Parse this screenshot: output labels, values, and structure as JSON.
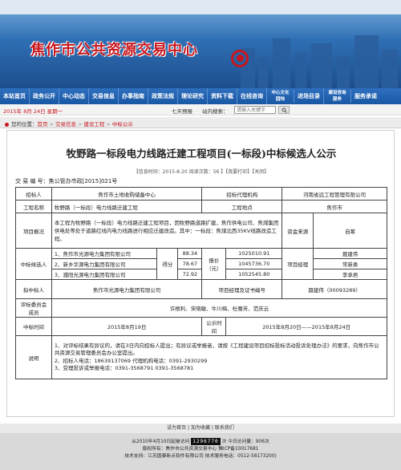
{
  "banner": {
    "title": "焦作市公共资源交易中心"
  },
  "nav": {
    "items": [
      "本站首页",
      "政务公开",
      "中心动态",
      "交易信息",
      "办事指南",
      "政策法规",
      "理论研究",
      "资料下载",
      "在线咨询"
    ],
    "small_items": [
      "中心文化园地",
      "进场目录",
      "建设咨询服务",
      "服务承诺"
    ]
  },
  "toolbar": {
    "date": "2015年 8月 24日 星期一",
    "weather": "七天预报",
    "search_label": "站内搜索：",
    "search_placeholder": "请输入关键字"
  },
  "breadcrumb": {
    "prefix": "您的位置：",
    "items": [
      "首页",
      "交易信息",
      "建设工程",
      "中标公示"
    ]
  },
  "article": {
    "title": "牧野路一标段电力线路迁建工程项目(一标段)中标候选人公示",
    "meta": "【信息时间：2015-8-20  阅读次数：56 】【我要打印】【关闭】",
    "doc_no": "交 易 编 号：焦公管办市政[2015]021号"
  },
  "table": {
    "label_tenderer": "招标人",
    "tenderer": "焦作市土地收购储备中心",
    "label_agent": "招标代理机构",
    "agent": "河南省远工程管理有限公司",
    "label_project": "工程名称",
    "project": "牧野路（一标段）电力线路迁建工程",
    "label_location": "工程地点",
    "location": "焦作市",
    "label_overview": "项目概况",
    "overview": "本工程为牧野路（一标段）电力线路迁建工程项目，因牧野路道路扩建，焦作供电公司、焦煤集团供电处等处于道路红线内电力线路进行相应迁建改造。其中：一标段：焦煤北西35KV线路改造工程。",
    "label_fund": "资金来源",
    "fund": "自筹",
    "label_candidates": "中标候选人",
    "candidates": [
      "1、焦作市光源电力集团有限公司",
      "2、新乡华源电力集团有限公司",
      "3、濮阳光源电力集团有限公司"
    ],
    "scores": [
      "88.34",
      "78.67",
      "72.92"
    ],
    "label_score": "得分",
    "label_price": "报价（元）",
    "prices": [
      "1025010.91",
      "1045736.70",
      "1052545.80"
    ],
    "label_pm": "项目经理",
    "pms": [
      "聂建伟",
      "常新勇",
      "李承君"
    ],
    "label_winner": "拟中标人",
    "winner": "焦作市光源电力集团有限公司",
    "label_cert": "项目经理及证书编号",
    "cert": "聂建伟（00093289）",
    "label_committee": "评标委员会成员",
    "committee": "许根利、宋晓敏、牛川梅、杜骞芳、范庆云",
    "label_bid_time": "中标时间",
    "bid_time": "2015年8月19日",
    "label_notice_time": "公示时间",
    "notice_time": "2015年8月20日——2015年8月24日",
    "label_note": "说明",
    "notes": [
      "1、对评标结果有异议的，请在3日内向招标人提出；有异议或举报者，请按《工程建设项目招标投标活动投诉处理办法》的要求，向焦作市公共资源交易管理委员会办公室提出。",
      "2、招标人电话：18639137069          代理机构电话：0391-2930299",
      "3、受理投诉或举报电话：0391-3568791    0391-3568781"
    ]
  },
  "footer": {
    "links": [
      "设为首页",
      "加为收藏",
      "联系我们"
    ],
    "counter_prefix": "从2010年4月10日起被访问",
    "counter": "1296770",
    "counter_suffix": "次 今日访问量：906次",
    "host": "版权所有：焦作市公共资源交易中心  豫ICP备10017681",
    "support": "技术支持：江苏国泰新点软件有限公司 技术服务电话：0512-58173200)"
  },
  "colors": {
    "accent": "#c8161d",
    "nav": "#1857a3"
  }
}
